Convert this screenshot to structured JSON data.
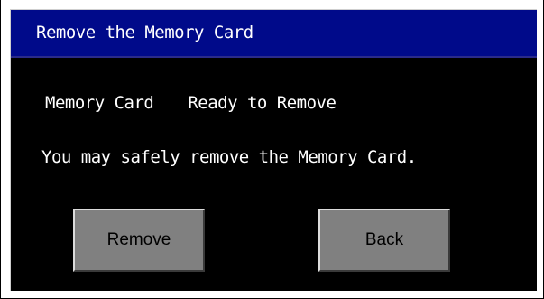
{
  "dialog": {
    "title": "Remove the Memory Card",
    "status": {
      "label": "Memory Card",
      "value": "Ready to Remove"
    },
    "message": "You may safely remove the Memory Card.",
    "buttons": {
      "remove_label": "Remove",
      "back_label": "Back"
    }
  },
  "colors": {
    "title_bar": "#000a8a",
    "background": "#000000",
    "text": "#ffffff",
    "button_face": "#808080"
  }
}
